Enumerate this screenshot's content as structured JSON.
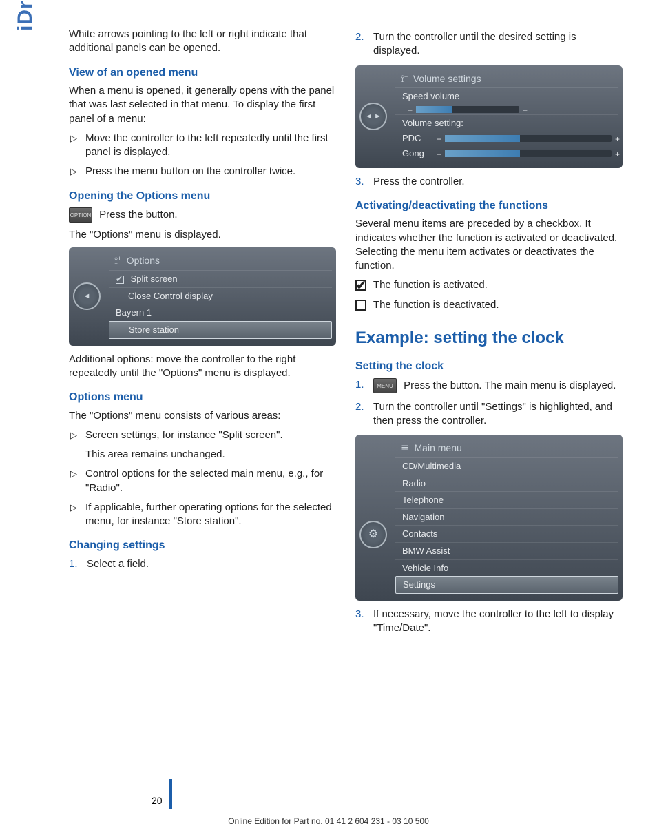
{
  "sidebar": "iDrive",
  "left": {
    "intro": "White arrows pointing to the left or right indicate that additional panels can be opened.",
    "h_view": "View of an opened menu",
    "view_p": "When a menu is opened, it generally opens with the panel that was last selected in that menu. To display the first panel of a menu:",
    "view_li1": "Move the controller to the left repeatedly until the first panel is displayed.",
    "view_li2": "Press the menu button on the controller twice.",
    "h_open": "Opening the Options menu",
    "option_btn": "OPTION",
    "open_p1": "Press the button.",
    "open_p2": "The \"Options\" menu is displayed.",
    "shot_options": {
      "title": "Options",
      "row1": "Split screen",
      "row2": "Close Control display",
      "row3": "Bayern 1",
      "row4": "Store station"
    },
    "open_p3": "Additional options: move the controller to the right repeatedly until the \"Options\" menu is displayed.",
    "h_opt": "Options menu",
    "opt_p": "The \"Options\" menu consists of various areas:",
    "opt_li1": "Screen settings, for instance \"Split screen\".",
    "opt_li1b": "This area remains unchanged.",
    "opt_li2": "Control options for the selected main menu, e.g., for \"Radio\".",
    "opt_li3": "If applicable, further operating options for the selected menu, for instance \"Store station\".",
    "h_chg": "Changing settings",
    "chg_li1": "Select a field."
  },
  "right": {
    "step2": "Turn the controller until the desired setting is displayed.",
    "shot_vol": {
      "title": "Volume settings",
      "row1": "Speed volume",
      "row2": "Volume setting:",
      "pdc": "PDC",
      "gong": "Gong"
    },
    "step3": "Press the controller.",
    "h_act": "Activating/deactivating the functions",
    "act_p": "Several menu items are preceded by a checkbox. It indicates whether the function is activated or deactivated. Selecting the menu item activates or deactivates the function.",
    "act_on": "The function is activated.",
    "act_off": "The function is deactivated.",
    "h_example": "Example: setting the clock",
    "h_setclock": "Setting the clock",
    "menu_btn": "MENU",
    "sc_li1": "Press the button. The main menu is displayed.",
    "sc_li2": "Turn the controller until \"Settings\" is highlighted, and then press the controller.",
    "shot_main": {
      "title": "Main menu",
      "items": [
        "CD/Multimedia",
        "Radio",
        "Telephone",
        "Navigation",
        "Contacts",
        "BMW Assist",
        "Vehicle Info",
        "Settings"
      ]
    },
    "sc_li3": "If necessary, move the controller to the left to display \"Time/Date\"."
  },
  "page_number": "20",
  "footer": "Online Edition for Part no. 01 41 2 604 231 - 03 10 500"
}
